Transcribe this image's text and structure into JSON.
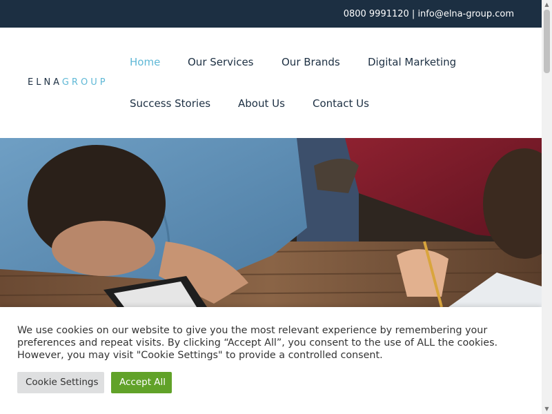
{
  "topbar": {
    "contact_text": "0800 9991120 | info@elna-group.com"
  },
  "header": {
    "logo_part1": "ELNA",
    "logo_part2": "GROUP",
    "nav": [
      {
        "label": "Home",
        "active": true
      },
      {
        "label": "Our Services"
      },
      {
        "label": "Our Brands"
      },
      {
        "label": "Digital Marketing"
      },
      {
        "label": "Success Stories"
      },
      {
        "label": "About Us"
      },
      {
        "label": "Contact Us"
      }
    ]
  },
  "cookie": {
    "message": "We use cookies on our website to give you the most relevant experience by remembering your preferences and repeat visits. By clicking “Accept All”, you consent to the use of ALL the cookies. However, you may visit \"Cookie Settings\" to provide a controlled consent.",
    "settings_label": "Cookie Settings",
    "accept_label": "Accept All"
  },
  "scrollbar": {
    "up_icon": "arrow-up-icon",
    "down_icon": "arrow-down-icon"
  },
  "colors": {
    "topbar_bg": "#1c2f42",
    "nav_text": "#1c2f42",
    "nav_active": "#5fb8d6",
    "accept_button": "#61a229",
    "settings_button": "#dedfe0"
  }
}
